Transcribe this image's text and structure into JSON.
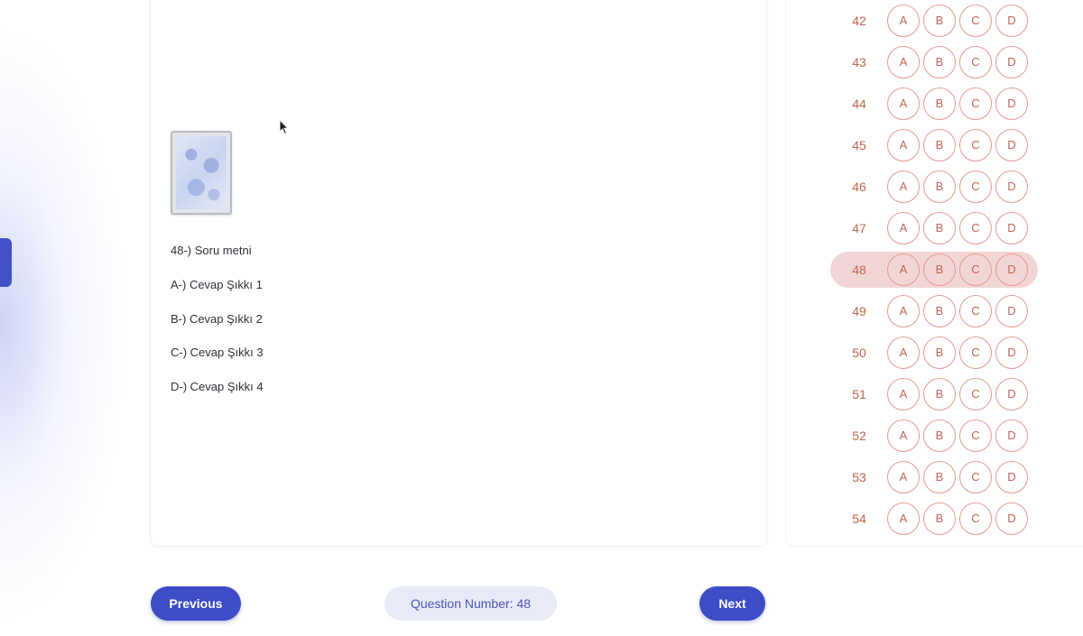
{
  "question": {
    "stem": "48-) Soru metni",
    "options": [
      "A-) Cevap Şıkkı 1",
      "B-) Cevap Şıkkı 2",
      "C-) Cevap Şıkkı 3",
      "D-) Cevap Şıkkı 4"
    ]
  },
  "answer_sheet": {
    "option_labels": [
      "A",
      "B",
      "C",
      "D"
    ],
    "active_question": "48",
    "rows": [
      "42",
      "43",
      "44",
      "45",
      "46",
      "47",
      "48",
      "49",
      "50",
      "51",
      "52",
      "53",
      "54"
    ]
  },
  "footer": {
    "previous_label": "Previous",
    "question_number_label": "Question Number: 48",
    "next_label": "Next"
  },
  "colors": {
    "primary": "#3d4dc6",
    "answer_accent": "#c2655a",
    "active_row_bg": "#f2d6d6"
  },
  "icons": {
    "cursor": "mouse-pointer-icon"
  }
}
